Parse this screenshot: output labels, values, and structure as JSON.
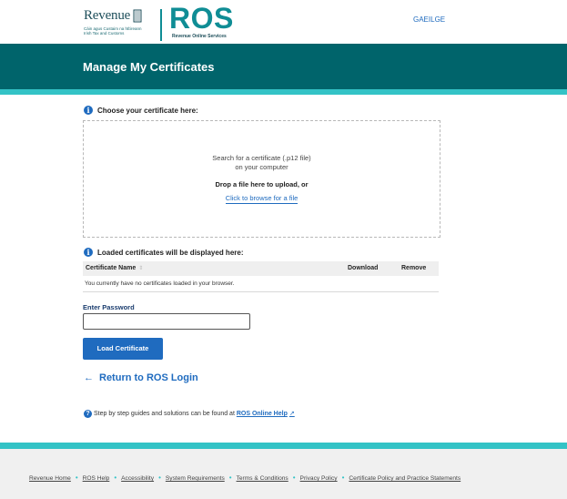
{
  "header": {
    "revenue_word": "Revenue",
    "revenue_sub1": "Cáin agus Custaim na hÉireann",
    "revenue_sub2": "Irish Tax and Customs",
    "ros_word": "ROS",
    "ros_sub": "Revenue Online Services",
    "language_link": "GAEILGE"
  },
  "banner": {
    "title": "Manage My Certificates"
  },
  "upload": {
    "heading": "Choose your certificate here:",
    "line1": "Search for a certificate (.p12 file)",
    "line2": "on your computer",
    "drop_text": "Drop a file here to upload, or",
    "browse_link": "Click to browse for a file"
  },
  "loaded": {
    "heading": "Loaded certificates will be displayed here:",
    "columns": {
      "name": "Certificate Name",
      "download": "Download",
      "remove": "Remove"
    },
    "sort_icon": "⇕",
    "empty_message": "You currently have no certificates loaded in your browser."
  },
  "password": {
    "label": "Enter Password",
    "value": ""
  },
  "load_button": "Load Certificate",
  "return_link": "Return to ROS Login",
  "help": {
    "text": "Step by step guides and solutions can be found at",
    "link": "ROS Online Help",
    "link_icon": "↗"
  },
  "footer": {
    "links": [
      "Revenue Home",
      "ROS Help",
      "Accessibility",
      "System Requirements",
      "Terms & Conditions",
      "Privacy Policy",
      "Certificate Policy and Practice Statements"
    ],
    "separator": "•"
  },
  "colors": {
    "teal_dark": "#00646b",
    "teal_light": "#33c3c6",
    "link_blue": "#1f6bbf"
  }
}
